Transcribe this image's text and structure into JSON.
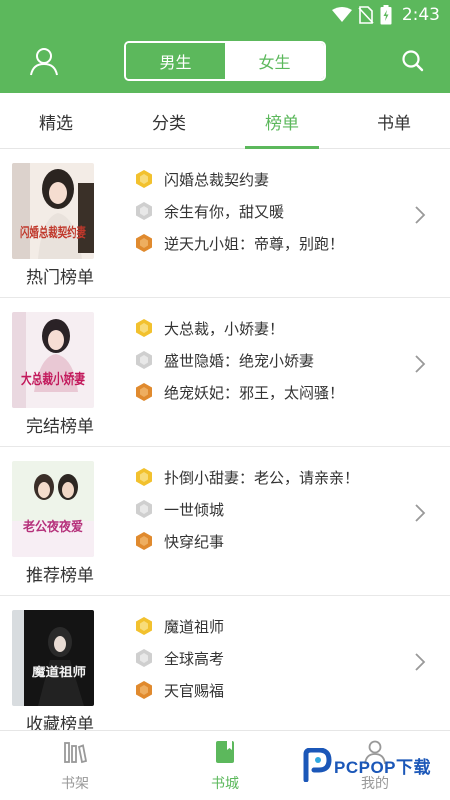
{
  "status_bar": {
    "time": "2:43"
  },
  "header": {
    "gender_tabs": [
      {
        "label": "男生",
        "active": false
      },
      {
        "label": "女生",
        "active": true
      }
    ]
  },
  "tabs": [
    {
      "label": "精选",
      "active": false
    },
    {
      "label": "分类",
      "active": false
    },
    {
      "label": "榜单",
      "active": true
    },
    {
      "label": "书单",
      "active": false
    }
  ],
  "sections": [
    {
      "label": "热门榜单",
      "cover_text": "闪婚总裁契约妻",
      "items": [
        "闪婚总裁契约妻",
        "余生有你，甜又暖",
        "逆天九小姐：帝尊，别跑！"
      ]
    },
    {
      "label": "完结榜单",
      "cover_text": "大总裁小娇妻",
      "items": [
        "大总裁，小娇妻！",
        "盛世隐婚：绝宠小娇妻",
        "绝宠妖妃：邪王，太闷骚！"
      ]
    },
    {
      "label": "推荐榜单",
      "cover_text": "老公夜夜爱",
      "items": [
        "扑倒小甜妻：老公，请亲亲！",
        "一世倾城",
        "快穿纪事"
      ]
    },
    {
      "label": "收藏榜单",
      "cover_text": "魔道祖师",
      "items": [
        "魔道祖师",
        "全球高考",
        "天官赐福"
      ]
    }
  ],
  "bottom_nav": [
    {
      "label": "书架",
      "icon": "bookshelf-icon",
      "active": false
    },
    {
      "label": "书城",
      "icon": "bookstore-icon",
      "active": true
    },
    {
      "label": "我的",
      "icon": "profile-icon",
      "active": false
    }
  ],
  "watermark": {
    "text": "PCPOP下载"
  },
  "colors": {
    "primary": "#5cb85c",
    "medal_gold": "#f2c12e",
    "medal_silver": "#cfcfcf",
    "medal_bronze": "#e08a2e"
  }
}
